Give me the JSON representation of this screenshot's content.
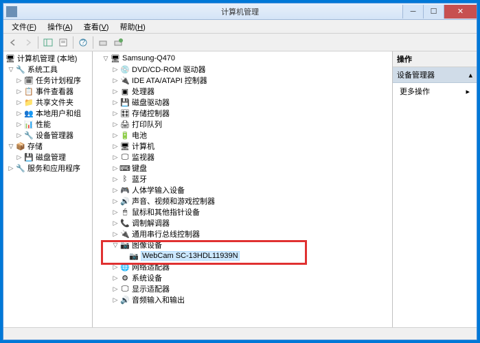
{
  "title": "计算机管理",
  "menus": [
    {
      "label": "文件",
      "key": "F"
    },
    {
      "label": "操作",
      "key": "A"
    },
    {
      "label": "查看",
      "key": "V"
    },
    {
      "label": "帮助",
      "key": "H"
    }
  ],
  "left_tree": {
    "root": "计算机管理 (本地)",
    "groups": [
      {
        "label": "系统工具",
        "children": [
          "任务计划程序",
          "事件查看器",
          "共享文件夹",
          "本地用户和组",
          "性能",
          "设备管理器"
        ]
      },
      {
        "label": "存储",
        "children": [
          "磁盘管理"
        ]
      },
      {
        "label": "服务和应用程序",
        "children": []
      }
    ]
  },
  "mid_tree": {
    "root": "Samsung-Q470",
    "items": [
      {
        "label": "DVD/CD-ROM 驱动器",
        "expander": "▷"
      },
      {
        "label": "IDE ATA/ATAPI 控制器",
        "expander": "▷"
      },
      {
        "label": "处理器",
        "expander": "▷"
      },
      {
        "label": "磁盘驱动器",
        "expander": "▷"
      },
      {
        "label": "存储控制器",
        "expander": "▷"
      },
      {
        "label": "打印队列",
        "expander": "▷"
      },
      {
        "label": "电池",
        "expander": "▷"
      },
      {
        "label": "计算机",
        "expander": "▷"
      },
      {
        "label": "监视器",
        "expander": "▷"
      },
      {
        "label": "键盘",
        "expander": "▷"
      },
      {
        "label": "蓝牙",
        "expander": "▷"
      },
      {
        "label": "人体学输入设备",
        "expander": "▷"
      },
      {
        "label": "声音、视频和游戏控制器",
        "expander": "▷"
      },
      {
        "label": "鼠标和其他指针设备",
        "expander": "▷"
      },
      {
        "label": "调制解调器",
        "expander": "▷"
      },
      {
        "label": "通用串行总线控制器",
        "expander": "▷"
      },
      {
        "label": "图像设备",
        "expander": "▽",
        "expanded": true,
        "children": [
          {
            "label": "WebCam SC-13HDL11939N",
            "selected": true
          }
        ]
      },
      {
        "label": "网络适配器",
        "expander": "▷"
      },
      {
        "label": "系统设备",
        "expander": "▷"
      },
      {
        "label": "显示适配器",
        "expander": "▷"
      },
      {
        "label": "音频输入和输出",
        "expander": "▷"
      }
    ]
  },
  "actions": {
    "header": "操作",
    "section": "设备管理器",
    "more": "更多操作"
  }
}
